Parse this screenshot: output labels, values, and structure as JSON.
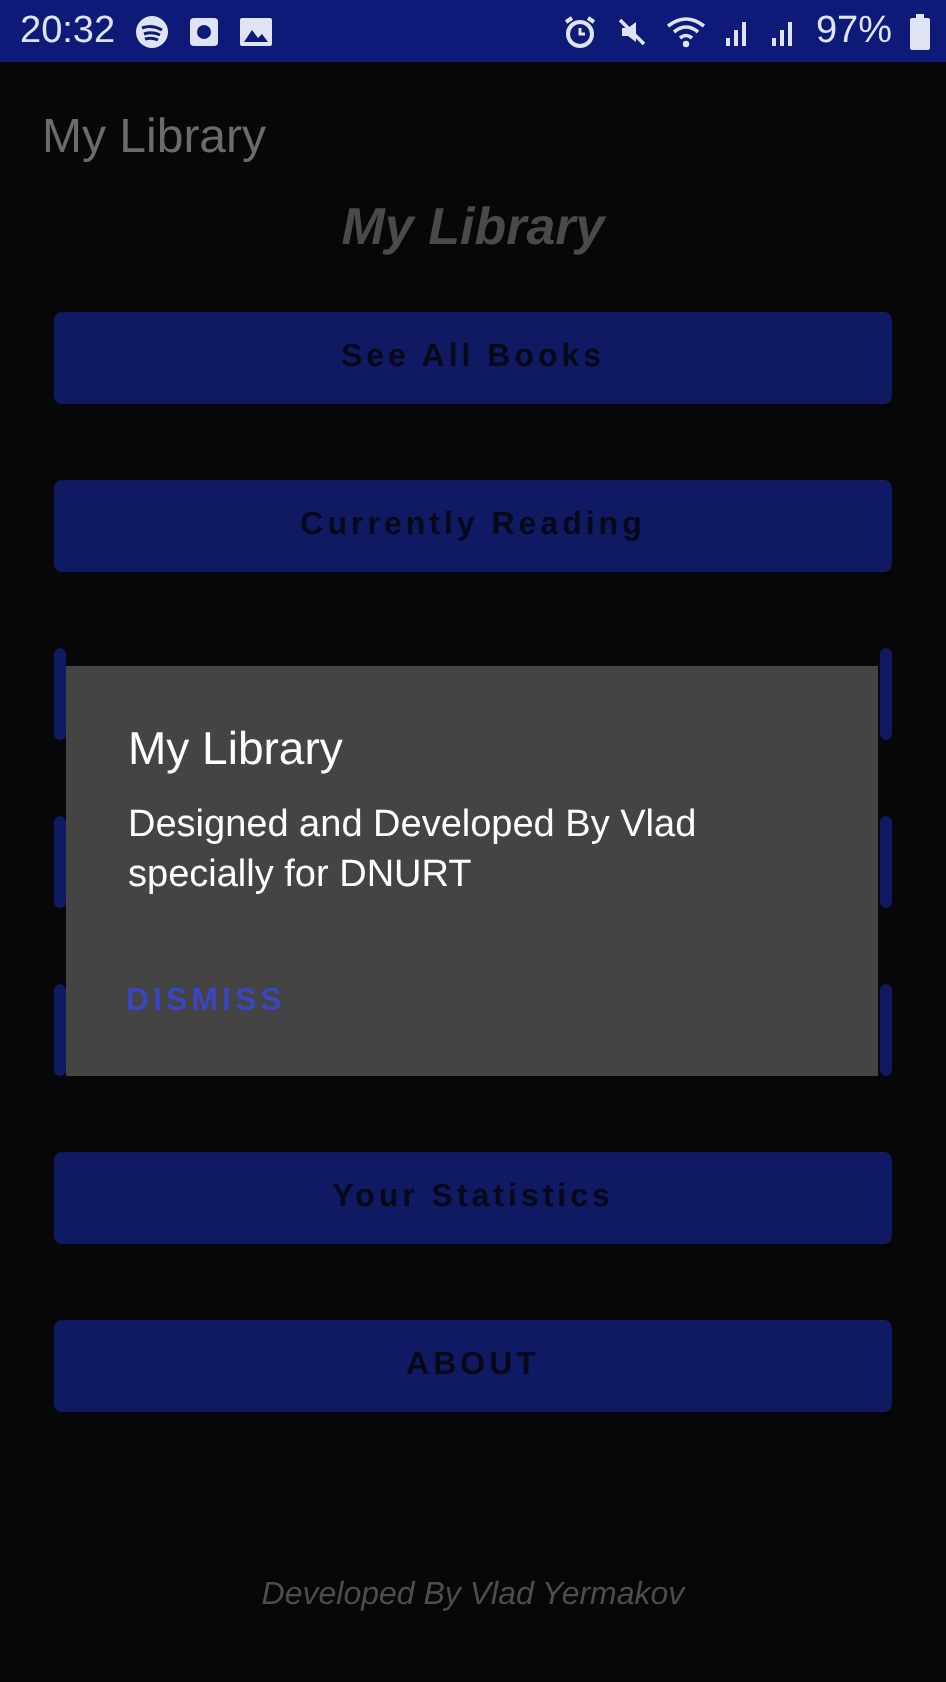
{
  "status_bar": {
    "time": "20:32",
    "battery": "97%"
  },
  "app_bar": {
    "title": "My Library"
  },
  "heading": "My Library",
  "buttons": [
    {
      "kind": "button",
      "label": "See All Books"
    },
    {
      "kind": "button",
      "label": "Currently Reading"
    },
    {
      "kind": "covered"
    },
    {
      "kind": "covered"
    },
    {
      "kind": "covered"
    },
    {
      "kind": "button",
      "label": "Your Statistics"
    },
    {
      "kind": "button",
      "label": "ABOUT"
    }
  ],
  "dialog": {
    "title": "My Library",
    "message": "Designed and Developed By Vlad specially for DNURT",
    "action": "DISMISS"
  },
  "footer": "Developed By Vlad Yermakov"
}
